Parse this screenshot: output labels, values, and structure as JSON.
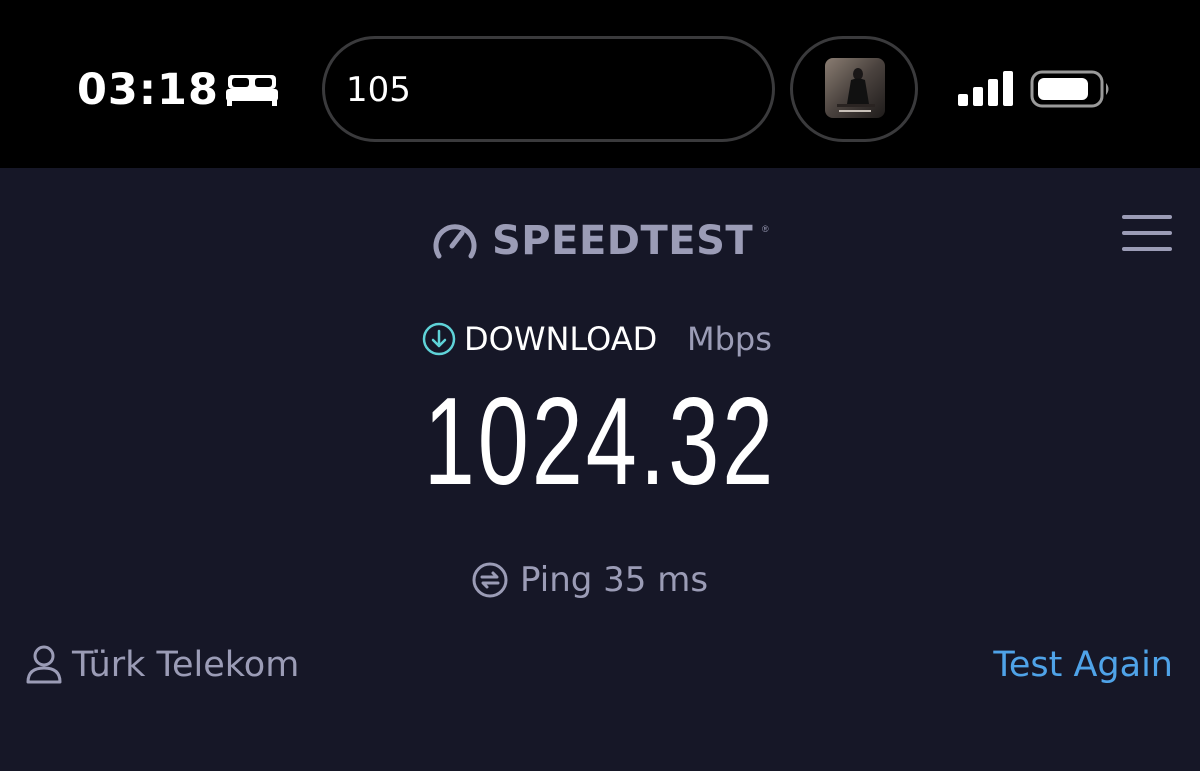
{
  "status_bar": {
    "time": "03:18",
    "island_text": "105",
    "icons": [
      "bed-icon",
      "album-art",
      "signal-icon",
      "battery-icon"
    ]
  },
  "header": {
    "logo_text": "SPEEDTEST",
    "trademark": "®",
    "logo_icon": "gauge-icon",
    "menu_icon": "hamburger-menu-icon"
  },
  "download": {
    "label": "DOWNLOAD",
    "unit": "Mbps",
    "value": "1024.32",
    "icon": "download-arrow-icon"
  },
  "ping": {
    "label": "Ping 35 ms",
    "icon": "ping-icon"
  },
  "footer": {
    "isp": "Türk Telekom",
    "isp_icon": "user-icon",
    "test_again": "Test Again"
  },
  "colors": {
    "background": "#161727",
    "status_bar": "#000000",
    "muted_text": "#9b9cb6",
    "accent_link": "#4fa3e8",
    "download_accent": "#5fd3d8"
  }
}
